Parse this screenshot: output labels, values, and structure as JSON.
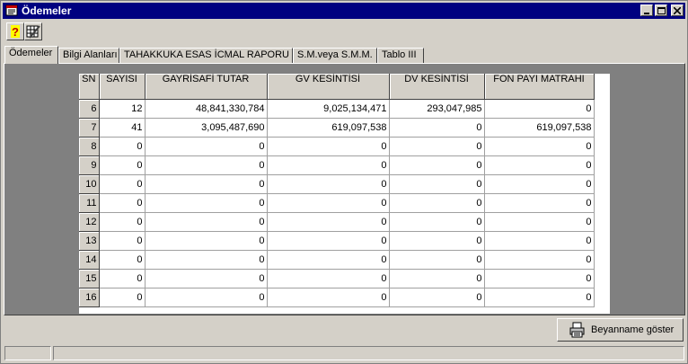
{
  "window": {
    "title": "Ödemeler"
  },
  "toolbar": {
    "help_icon": "question-help-icon",
    "edit_icon": "pencil-grid-icon"
  },
  "tabs": [
    {
      "label": "Ödemeler",
      "active": true
    },
    {
      "label": "Bilgi Alanları",
      "active": false
    },
    {
      "label": "TAHAKKUKA ESAS İCMAL RAPORU",
      "active": false
    },
    {
      "label": "S.M.veya S.M.M.",
      "active": false
    },
    {
      "label": "Tablo III",
      "active": false
    }
  ],
  "table": {
    "headers": [
      "SN",
      "SAYISI",
      "GAYRİSAFİ TUTAR",
      "GV KESİNTİSİ",
      "DV KESİNTİSİ",
      "FON PAYI MATRAHI"
    ],
    "rows": [
      [
        "6",
        "12",
        "48,841,330,784",
        "9,025,134,471",
        "293,047,985",
        "0"
      ],
      [
        "7",
        "41",
        "3,095,487,690",
        "619,097,538",
        "0",
        "619,097,538"
      ],
      [
        "8",
        "0",
        "0",
        "0",
        "0",
        "0"
      ],
      [
        "9",
        "0",
        "0",
        "0",
        "0",
        "0"
      ],
      [
        "10",
        "0",
        "0",
        "0",
        "0",
        "0"
      ],
      [
        "11",
        "0",
        "0",
        "0",
        "0",
        "0"
      ],
      [
        "12",
        "0",
        "0",
        "0",
        "0",
        "0"
      ],
      [
        "13",
        "0",
        "0",
        "0",
        "0",
        "0"
      ],
      [
        "14",
        "0",
        "0",
        "0",
        "0",
        "0"
      ],
      [
        "15",
        "0",
        "0",
        "0",
        "0",
        "0"
      ],
      [
        "16",
        "0",
        "0",
        "0",
        "0",
        "0"
      ]
    ]
  },
  "actions": {
    "show_return_label": "Beyanname göster",
    "show_return_icon": "printer-icon"
  }
}
